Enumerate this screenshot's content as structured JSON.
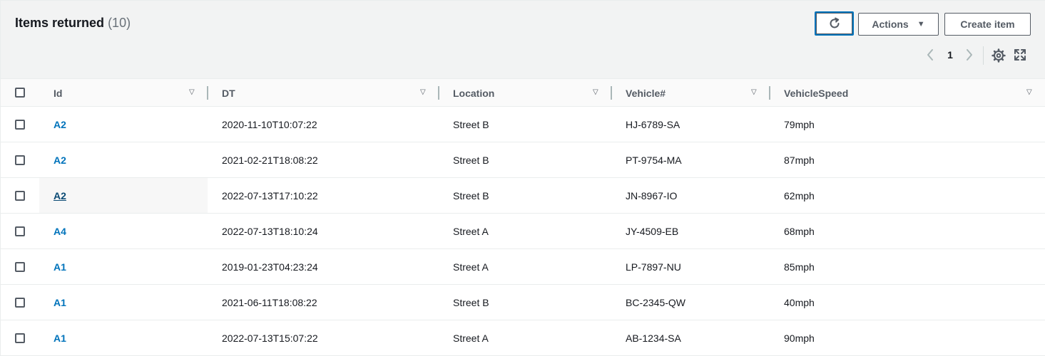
{
  "header": {
    "title": "Items returned",
    "count": "(10)",
    "actions_label": "Actions",
    "create_label": "Create item"
  },
  "pagination": {
    "current_page": "1"
  },
  "icons": {
    "refresh": "refresh-icon",
    "caret": "caret-down-icon",
    "prev": "chevron-left-icon",
    "next": "chevron-right-icon",
    "settings": "gear-icon",
    "expand": "expand-icon",
    "sort": "sort-triangle-icon"
  },
  "colors": {
    "link": "#0073bb",
    "header_bg": "#f2f3f3",
    "focus_ring": "#0073bb"
  },
  "table": {
    "columns": [
      "Id",
      "DT",
      "Location",
      "Vehicle#",
      "VehicleSpeed"
    ],
    "rows": [
      {
        "id": "A2",
        "dt": "2020-11-10T10:07:22",
        "location": "Street B",
        "vehicle": "HJ-6789-SA",
        "speed": "79mph"
      },
      {
        "id": "A2",
        "dt": "2021-02-21T18:08:22",
        "location": "Street B",
        "vehicle": "PT-9754-MA",
        "speed": "87mph"
      },
      {
        "id": "A2",
        "dt": "2022-07-13T17:10:22",
        "location": "Street B",
        "vehicle": "JN-8967-IO",
        "speed": "62mph"
      },
      {
        "id": "A4",
        "dt": "2022-07-13T18:10:24",
        "location": "Street A",
        "vehicle": "JY-4509-EB",
        "speed": "68mph"
      },
      {
        "id": "A1",
        "dt": "2019-01-23T04:23:24",
        "location": "Street A",
        "vehicle": "LP-7897-NU",
        "speed": "85mph"
      },
      {
        "id": "A1",
        "dt": "2021-06-11T18:08:22",
        "location": "Street B",
        "vehicle": "BC-2345-QW",
        "speed": "40mph"
      },
      {
        "id": "A1",
        "dt": "2022-07-13T15:07:22",
        "location": "Street A",
        "vehicle": "AB-1234-SA",
        "speed": "90mph"
      }
    ]
  }
}
